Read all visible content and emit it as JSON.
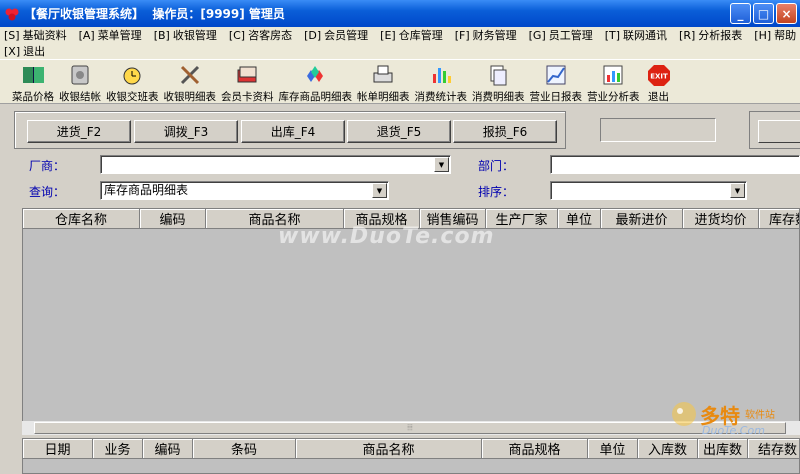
{
  "window": {
    "title": "【餐厅收银管理系统】  操作员：[9999] 管理员",
    "buttons": [
      "_",
      "□",
      "×"
    ]
  },
  "menu": {
    "row1": [
      {
        "key": "[S]",
        "label": "基础资料"
      },
      {
        "key": "[A]",
        "label": "菜单管理"
      },
      {
        "key": "[B]",
        "label": "收银管理"
      },
      {
        "key": "[C]",
        "label": "咨客房态"
      },
      {
        "key": "[D]",
        "label": "会员管理"
      },
      {
        "key": "[E]",
        "label": "仓库管理"
      },
      {
        "key": "[F]",
        "label": "财务管理"
      },
      {
        "key": "[G]",
        "label": "员工管理"
      },
      {
        "key": "[T]",
        "label": "联网通讯"
      },
      {
        "key": "[R]",
        "label": "分析报表"
      },
      {
        "key": "[H]",
        "label": "帮助"
      }
    ],
    "row2": [
      {
        "key": "[X]",
        "label": "退出"
      }
    ]
  },
  "toolbar": [
    {
      "label": "菜品价格",
      "icon": "book-icon"
    },
    {
      "label": "收银结帐",
      "icon": "cash-register-icon"
    },
    {
      "label": "收银交班表",
      "icon": "alarm-clock-icon"
    },
    {
      "label": "收银明细表",
      "icon": "tools-icon"
    },
    {
      "label": "会员卡资料",
      "icon": "card-stack-icon"
    },
    {
      "label": "库存商品明细表",
      "icon": "gems-icon"
    },
    {
      "label": "帐单明细表",
      "icon": "printer-icon"
    },
    {
      "label": "消费统计表",
      "icon": "bar-chart-icon"
    },
    {
      "label": "消费明细表",
      "icon": "documents-icon"
    },
    {
      "label": "营业日报表",
      "icon": "line-chart-icon"
    },
    {
      "label": "营业分析表",
      "icon": "analysis-icon"
    },
    {
      "label": "退出",
      "icon": "exit-icon"
    }
  ],
  "actions": [
    "进货_F2",
    "调拨_F3",
    "出库_F4",
    "退货_F5",
    "报损_F6"
  ],
  "filters": {
    "vendor_label": "厂商：",
    "vendor_value": "",
    "dept_label": "部门：",
    "dept_value": "",
    "query_label": "查询：",
    "query_value": "库存商品明细表",
    "sort_label": "排序：",
    "sort_value": ""
  },
  "grid": {
    "columns": [
      "仓库名称",
      "编码",
      "商品名称",
      "商品规格",
      "销售编码",
      "生产厂家",
      "单位",
      "最新进价",
      "进货均价",
      "库存数"
    ]
  },
  "bottom_grid": {
    "columns": [
      "日期",
      "业务",
      "编码",
      "条码",
      "商品名称",
      "商品规格",
      "单位",
      "入库数",
      "出库数",
      "结存数"
    ]
  },
  "watermarks": {
    "center": "www.DuoTe.com",
    "brand": "多特",
    "brand_sub": "软件站",
    "url": "DuoTe.Com"
  }
}
